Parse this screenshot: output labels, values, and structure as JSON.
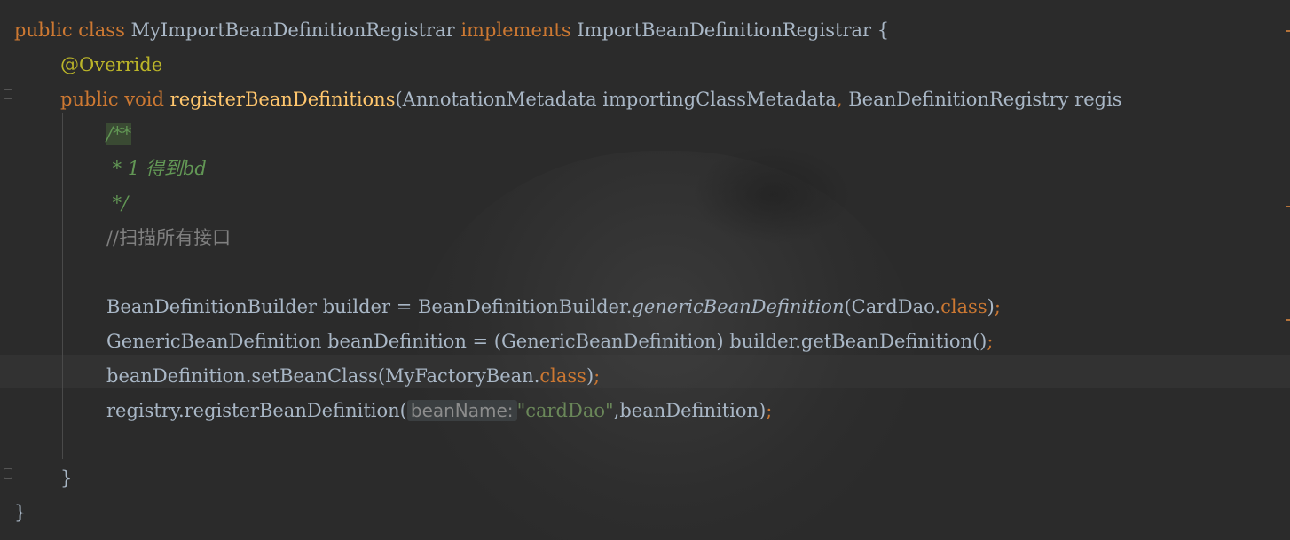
{
  "code": {
    "line1": {
      "kw_public": "public",
      "kw_class": "class",
      "class_name": "MyImportBeanDefinitionRegistrar",
      "kw_implements": "implements",
      "interface_name": "ImportBeanDefinitionRegistrar",
      "brace": "{"
    },
    "line2": {
      "annotation": "@Override"
    },
    "line3": {
      "kw_public": "public",
      "kw_void": "void",
      "method_name": "registerBeanDefinitions",
      "params_a": "(AnnotationMetadata importingClassMetadata",
      "comma": ",",
      "params_b": "BeanDefinitionRegistry regis"
    },
    "line4": {
      "doc_start": "/**"
    },
    "line5": {
      "doc_text": " * 1 得到bd"
    },
    "line6": {
      "doc_end": " */"
    },
    "line7": {
      "comment": "//扫描所有接口"
    },
    "line8": {
      "decl": "BeanDefinitionBuilder builder = BeanDefinitionBuilder.",
      "static_call": "genericBeanDefinition",
      "args": "(CardDao.",
      "kw_class": "class",
      "close": ")",
      "semi": ";"
    },
    "line9": {
      "decl": "GenericBeanDefinition beanDefinition = (GenericBeanDefinition) builder.getBeanDefinition()",
      "semi": ";"
    },
    "line10": {
      "call": "beanDefinition.setBeanClass(MyFactoryBean.",
      "kw_class": "class",
      "close": ")",
      "semi": ";"
    },
    "line11": {
      "call": "registry.registerBeanDefinition(",
      "hint": "beanName:",
      "string": "\"cardDao\"",
      "rest": ",beanDefinition)",
      "semi": ";"
    },
    "line12": {
      "brace": "}"
    },
    "line13": {
      "brace": "}"
    }
  }
}
